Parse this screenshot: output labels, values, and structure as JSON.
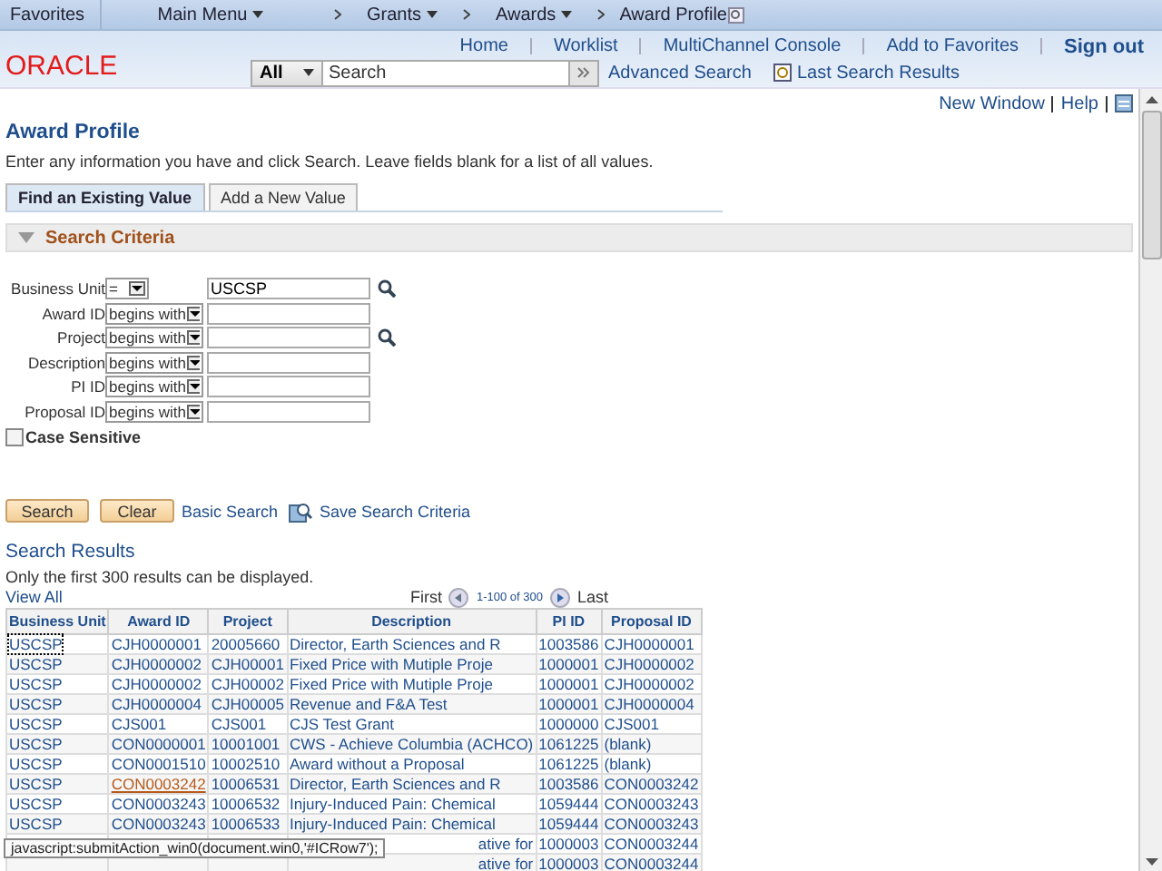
{
  "nav": {
    "favorites": "Favorites",
    "main_menu": "Main Menu",
    "crumbs": [
      "Grants",
      "Awards"
    ],
    "current": "Award Profile"
  },
  "header_links": [
    "Home",
    "Worklist",
    "MultiChannel Console",
    "Add to Favorites"
  ],
  "sign_out": "Sign out",
  "logo": "ORACLE",
  "search": {
    "scope": "All",
    "placeholder": "Search",
    "advanced": "Advanced Search",
    "last_results": "Last Search Results"
  },
  "page_links": [
    "New Window",
    "Help"
  ],
  "title": "Award Profile",
  "instruction": "Enter any information you have and click Search. Leave fields blank for a list of all values.",
  "tabs": [
    {
      "label": "Find an Existing Value",
      "selected": true
    },
    {
      "label": "Add a New Value",
      "selected": false
    }
  ],
  "section": {
    "title": "Search Criteria",
    "expanded": true
  },
  "criteria": [
    {
      "label": "Business Unit",
      "operator": "=",
      "value": "USCSP",
      "lookup": true
    },
    {
      "label": "Award ID",
      "operator": "begins with",
      "lookup": false
    },
    {
      "label": "Project",
      "operator": "begins with",
      "lookup": true
    },
    {
      "label": "Description",
      "operator": "begins with",
      "lookup": false
    },
    {
      "label": "PI ID",
      "operator": "begins with",
      "lookup": false
    },
    {
      "label": "Proposal ID",
      "operator": "begins with",
      "lookup": false
    }
  ],
  "case_sensitive": {
    "label": "Case Sensitive",
    "checked": false
  },
  "buttons": [
    "Search",
    "Clear"
  ],
  "basic_search": "Basic Search",
  "save_criteria": "Save Search Criteria",
  "results": {
    "title": "Search Results",
    "note": "Only the first 300 results can be displayed.",
    "view_all": "View All",
    "first": "First",
    "range": "1-100 of 300",
    "last": "Last",
    "columns": [
      "Business Unit",
      "Award ID",
      "Project",
      "Description",
      "PI ID",
      "Proposal ID"
    ],
    "rows": [
      {
        "cells": [
          "USCSP",
          "CJH0000001",
          "20005660",
          "Director, Earth Sciences and R",
          "1003586",
          "CJH0000001"
        ],
        "focused": true,
        "hovered": false
      },
      {
        "cells": [
          "USCSP",
          "CJH0000002",
          "CJH00001",
          "Fixed Price with Mutiple Proje",
          "1000001",
          "CJH0000002"
        ],
        "focused": false,
        "hovered": false
      },
      {
        "cells": [
          "USCSP",
          "CJH0000002",
          "CJH00002",
          "Fixed Price with Mutiple Proje",
          "1000001",
          "CJH0000002"
        ],
        "focused": false,
        "hovered": false
      },
      {
        "cells": [
          "USCSP",
          "CJH0000004",
          "CJH00005",
          "Revenue and F&A Test",
          "1000001",
          "CJH0000004"
        ],
        "focused": false,
        "hovered": false
      },
      {
        "cells": [
          "USCSP",
          "CJS001",
          "CJS001",
          "CJS Test Grant",
          "1000000",
          "CJS001"
        ],
        "focused": false,
        "hovered": false
      },
      {
        "cells": [
          "USCSP",
          "CON0000001",
          "10001001",
          "CWS - Achieve Columbia (ACHCO)",
          "1061225",
          "(blank)"
        ],
        "focused": false,
        "hovered": false
      },
      {
        "cells": [
          "USCSP",
          "CON0001510",
          "10002510",
          "Award without a Proposal",
          "1061225",
          "(blank)"
        ],
        "focused": false,
        "hovered": false
      },
      {
        "cells": [
          "USCSP",
          "CON0003242",
          "10006531",
          "Director, Earth Sciences and R",
          "1003586",
          "CON0003242"
        ],
        "focused": false,
        "hovered": true
      },
      {
        "cells": [
          "USCSP",
          "CON0003243",
          "10006532",
          "Injury-Induced Pain:  Chemical",
          "1059444",
          "CON0003243"
        ],
        "focused": false,
        "hovered": false
      },
      {
        "cells": [
          "USCSP",
          "CON0003243",
          "10006533",
          "Injury-Induced Pain:  Chemical",
          "1059444",
          "CON0003243"
        ],
        "focused": false,
        "hovered": false
      },
      {
        "cells": [
          null,
          null,
          null,
          "ative for",
          "1000003",
          "CON0003244"
        ],
        "partial": true
      },
      {
        "cells": [
          null,
          null,
          null,
          "ative for",
          "1000003",
          "CON0003244"
        ],
        "partial": true
      }
    ]
  },
  "status_tip": "javascript:submitAction_win0(document.win0,'#ICRow7');"
}
